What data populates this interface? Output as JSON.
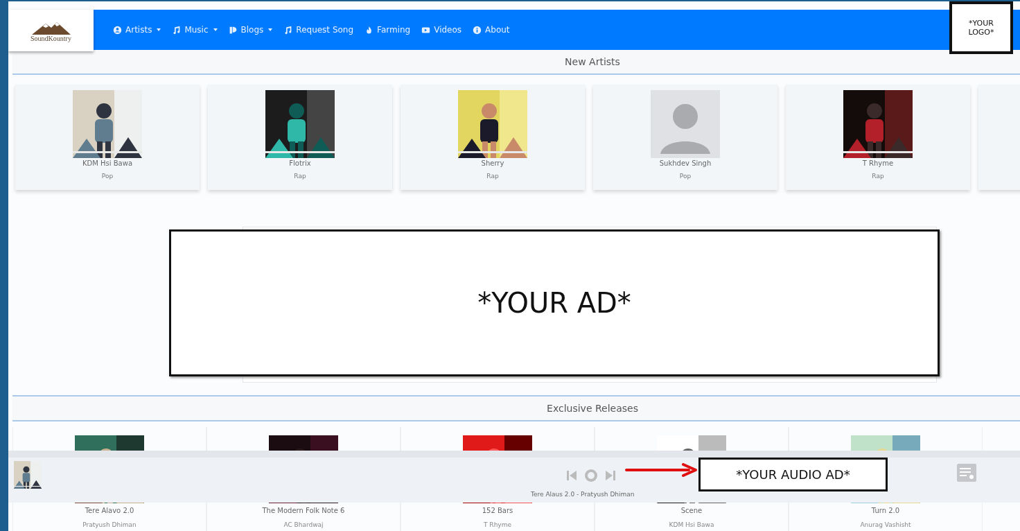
{
  "header": {
    "logo": {
      "text": "SoundKountry"
    },
    "nav": [
      {
        "label": "Artists",
        "kind": "user",
        "dropdown": true
      },
      {
        "label": "Music",
        "kind": "music",
        "dropdown": true
      },
      {
        "label": "Blogs",
        "kind": "blog",
        "dropdown": true
      },
      {
        "label": "Request Song",
        "kind": "music",
        "dropdown": false
      },
      {
        "label": "Farming",
        "kind": "fire",
        "dropdown": false
      },
      {
        "label": "Videos",
        "kind": "video",
        "dropdown": false
      },
      {
        "label": "About",
        "kind": "info",
        "dropdown": false
      }
    ]
  },
  "new_artists": {
    "title": "New Artists",
    "cards": [
      {
        "name": "KDM Hsi Bawa",
        "genre": "Pop",
        "kind": "picture"
      },
      {
        "name": "Flotrix",
        "genre": "Rap",
        "kind": "picture"
      },
      {
        "name": "Sherry",
        "genre": "Rap",
        "kind": "picture"
      },
      {
        "name": "Sukhdev Singh",
        "genre": "Pop",
        "kind": "avatar"
      },
      {
        "name": "T Rhyme",
        "genre": "Rap",
        "kind": "picture"
      }
    ]
  },
  "exclusive_releases": {
    "title": "Exclusive Releases",
    "cards": [
      {
        "title": "Tere Alavo 2.0",
        "artist": "Pratyush Dhiman"
      },
      {
        "title": "The Modern Folk Note 6",
        "artist": "AC Bhardwaj"
      },
      {
        "title": "152 Bars",
        "artist": "T Rhyme"
      },
      {
        "title": "Scene",
        "artist": "KDM Hsi Bawa"
      },
      {
        "title": "Turn 2.0",
        "artist": "Anurag Vashisht"
      }
    ]
  },
  "player": {
    "now_playing": "Tere Alaus 2.0 - Pratyush Dhiman"
  },
  "placeholders": {
    "logo": "*YOUR LOGO*",
    "ad": "*YOUR AD*",
    "audio_ad": "*YOUR AUDIO AD*"
  }
}
